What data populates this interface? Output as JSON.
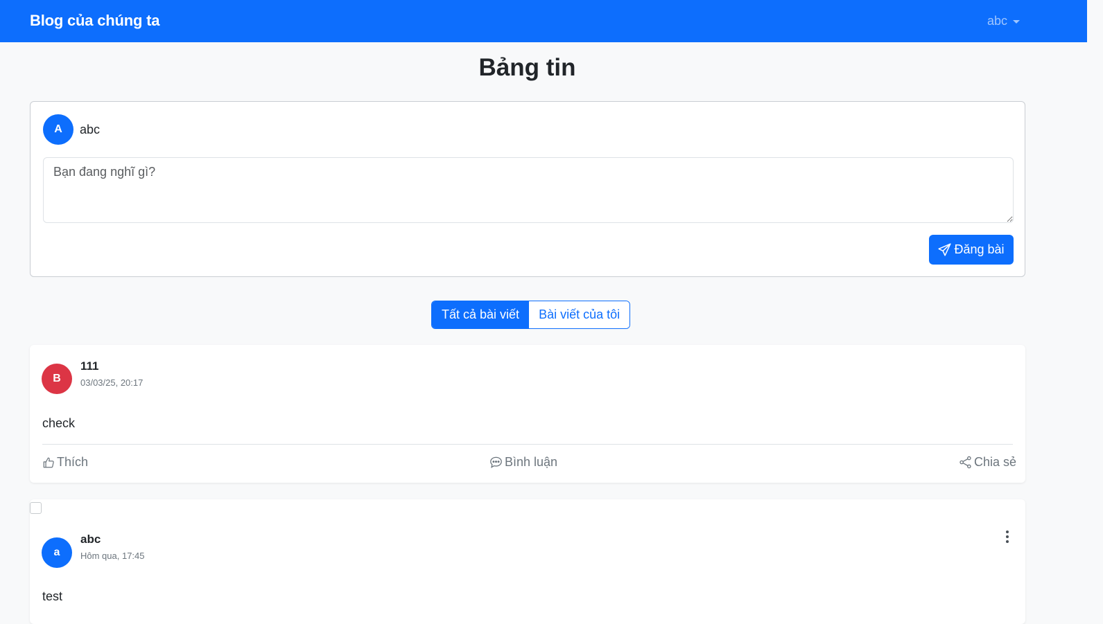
{
  "navbar": {
    "brand": "Blog của chúng ta",
    "user": "abc"
  },
  "page": {
    "title": "Bảng tin"
  },
  "composer": {
    "avatar_letter": "A",
    "username": "abc",
    "placeholder": "Bạn đang nghĩ gì?",
    "post_button": "Đăng bài"
  },
  "tabs": [
    {
      "label": "Tất cả bài viết",
      "active": true
    },
    {
      "label": "Bài viết của tôi",
      "active": false
    }
  ],
  "posts": [
    {
      "avatar_letter": "B",
      "avatar_color": "#dc3545",
      "author": "111",
      "timestamp": "03/03/25, 20:17",
      "content": "check",
      "actions": {
        "like": "Thích",
        "comment": "Bình luận",
        "share": "Chia sẻ"
      }
    },
    {
      "avatar_letter": "a",
      "avatar_color": "#0d6efd",
      "author": "abc",
      "timestamp": "Hôm qua, 17:45",
      "content": "test"
    }
  ],
  "colors": {
    "primary": "#0d6efd",
    "danger": "#dc3545",
    "muted": "#6c757d",
    "background": "#f8f9fa"
  },
  "icons": [
    "send-icon",
    "thumbs-up-icon",
    "chat-bubble-icon",
    "share-icon",
    "more-vertical-icon",
    "caret-down-icon"
  ]
}
